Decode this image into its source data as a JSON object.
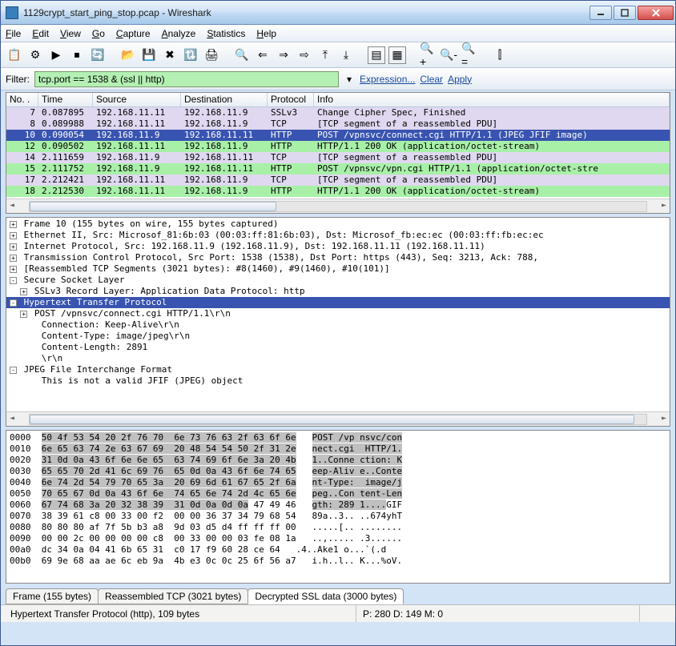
{
  "window": {
    "title": "1129crypt_start_ping_stop.pcap - Wireshark"
  },
  "menu": {
    "file": "File",
    "edit": "Edit",
    "view": "View",
    "go": "Go",
    "capture": "Capture",
    "analyze": "Analyze",
    "statistics": "Statistics",
    "help": "Help"
  },
  "filter": {
    "label": "Filter:",
    "value": "tcp.port == 1538 & (ssl || http)",
    "expression": "Expression...",
    "clear": "Clear",
    "apply": "Apply"
  },
  "packets": {
    "headers": {
      "no": "No. .",
      "time": "Time",
      "src": "Source",
      "dst": "Destination",
      "proto": "Protocol",
      "info": "Info"
    },
    "rows": [
      {
        "no": "7",
        "time": "0.087895",
        "src": "192.168.11.11",
        "dst": "192.168.11.9",
        "proto": "SSLv3",
        "info": "Change Cipher Spec, Finished",
        "cls": "row-lav"
      },
      {
        "no": "8",
        "time": "0.089988",
        "src": "192.168.11.11",
        "dst": "192.168.11.9",
        "proto": "TCP",
        "info": "[TCP segment of a reassembled PDU]",
        "cls": "row-lav"
      },
      {
        "no": "10",
        "time": "0.090054",
        "src": "192.168.11.9",
        "dst": "192.168.11.11",
        "proto": "HTTP",
        "info": "POST /vpnsvc/connect.cgi HTTP/1.1 (JPEG JFIF image)",
        "cls": "row-sel"
      },
      {
        "no": "12",
        "time": "0.090502",
        "src": "192.168.11.11",
        "dst": "192.168.11.9",
        "proto": "HTTP",
        "info": "HTTP/1.1 200 OK (application/octet-stream)",
        "cls": "row-green"
      },
      {
        "no": "14",
        "time": "2.111659",
        "src": "192.168.11.9",
        "dst": "192.168.11.11",
        "proto": "TCP",
        "info": "[TCP segment of a reassembled PDU]",
        "cls": "row-lav"
      },
      {
        "no": "15",
        "time": "2.111752",
        "src": "192.168.11.9",
        "dst": "192.168.11.11",
        "proto": "HTTP",
        "info": "POST /vpnsvc/vpn.cgi HTTP/1.1 (application/octet-stre",
        "cls": "row-green"
      },
      {
        "no": "17",
        "time": "2.212421",
        "src": "192.168.11.11",
        "dst": "192.168.11.9",
        "proto": "TCP",
        "info": "[TCP segment of a reassembled PDU]",
        "cls": "row-lav"
      },
      {
        "no": "18",
        "time": "2.212530",
        "src": "192.168.11.11",
        "dst": "192.168.11.9",
        "proto": "HTTP",
        "info": "HTTP/1.1 200 OK (application/octet-stream)",
        "cls": "row-green"
      }
    ]
  },
  "details": {
    "lines": [
      {
        "t": "Frame 10 (155 bytes on wire, 155 bytes captured)",
        "ind": 0,
        "box": "+"
      },
      {
        "t": "Ethernet II, Src: Microsof_81:6b:03 (00:03:ff:81:6b:03), Dst: Microsof_fb:ec:ec (00:03:ff:fb:ec:ec",
        "ind": 0,
        "box": "+"
      },
      {
        "t": "Internet Protocol, Src: 192.168.11.9 (192.168.11.9), Dst: 192.168.11.11 (192.168.11.11)",
        "ind": 0,
        "box": "+"
      },
      {
        "t": "Transmission Control Protocol, Src Port: 1538 (1538), Dst Port: https (443), Seq: 3213, Ack: 788,",
        "ind": 0,
        "box": "+"
      },
      {
        "t": "[Reassembled TCP Segments (3021 bytes): #8(1460), #9(1460), #10(101)]",
        "ind": 0,
        "box": "+"
      },
      {
        "t": "Secure Socket Layer",
        "ind": 0,
        "box": "-"
      },
      {
        "t": "SSLv3 Record Layer: Application Data Protocol: http",
        "ind": 1,
        "box": "+"
      },
      {
        "t": "Hypertext Transfer Protocol",
        "ind": 0,
        "box": "-",
        "sel": true
      },
      {
        "t": "POST /vpnsvc/connect.cgi HTTP/1.1\\r\\n",
        "ind": 1,
        "box": "+"
      },
      {
        "t": "Connection: Keep-Alive\\r\\n",
        "ind": 2
      },
      {
        "t": "Content-Type: image/jpeg\\r\\n",
        "ind": 2
      },
      {
        "t": "Content-Length: 2891",
        "ind": 2
      },
      {
        "t": "\\r\\n",
        "ind": 2
      },
      {
        "t": "JPEG File Interchange Format",
        "ind": 0,
        "box": "-"
      },
      {
        "t": "This is not a valid JFIF (JPEG) object",
        "ind": 2
      }
    ]
  },
  "hex": {
    "lines": [
      {
        "off": "0000",
        "b": "50 4f 53 54 20 2f 76 70  6e 73 76 63 2f 63 6f 6e",
        "a": "POST /vp nsvc/con",
        "hi": true
      },
      {
        "off": "0010",
        "b": "6e 65 63 74 2e 63 67 69  20 48 54 54 50 2f 31 2e",
        "a": "nect.cgi  HTTP/1.",
        "hi": true
      },
      {
        "off": "0020",
        "b": "31 0d 0a 43 6f 6e 6e 65  63 74 69 6f 6e 3a 20 4b",
        "a": "1..Conne ction: K",
        "hi": true
      },
      {
        "off": "0030",
        "b": "65 65 70 2d 41 6c 69 76  65 0d 0a 43 6f 6e 74 65",
        "a": "eep-Aliv e..Conte",
        "hi": true
      },
      {
        "off": "0040",
        "b": "6e 74 2d 54 79 70 65 3a  20 69 6d 61 67 65 2f 6a",
        "a": "nt-Type:  image/j",
        "hi": true
      },
      {
        "off": "0050",
        "b": "70 65 67 0d 0a 43 6f 6e  74 65 6e 74 2d 4c 65 6e",
        "a": "peg..Con tent-Len",
        "hi": true
      },
      {
        "off": "0060",
        "b": "67 74 68 3a 20 32 38 39  31 0d 0a 0d 0a",
        "a": "gth: 289 1....",
        "hi": true,
        "tail_b": "47 49 46",
        "tail_a": "GIF"
      },
      {
        "off": "0070",
        "b": " 38 39 61 c8 00 33 00 f2  00 00 36 37 34 79 68 54",
        "a": " 89a..3.. ..674yhT"
      },
      {
        "off": "0080",
        "b": " 80 80 80 af 7f 5b b3 a8  9d 03 d5 d4 ff ff ff 00",
        "a": " .....[.. ........"
      },
      {
        "off": "0090",
        "b": " 00 00 2c 00 00 00 00 c8  00 33 00 00 03 fe 08 1a",
        "a": " ..,..... .3......"
      },
      {
        "off": "00a0",
        "b": " dc 34 0a 04 41 6b 65 31  c0 17 f9 60 28 ce 64",
        "a": " .4..Ake1 o...`(.d"
      },
      {
        "off": "00b0",
        "b": " 69 9e 68 aa ae 6c eb 9a  4b e3 0c 0c 25 6f 56 a7",
        "a": " i.h..l.. K...%oV."
      }
    ]
  },
  "hextabs": {
    "t1": "Frame (155 bytes)",
    "t2": "Reassembled TCP (3021 bytes)",
    "t3": "Decrypted SSL data (3000 bytes)"
  },
  "status": {
    "left": "Hypertext Transfer Protocol (http), 109 bytes",
    "mid": "P: 280 D: 149 M: 0"
  }
}
